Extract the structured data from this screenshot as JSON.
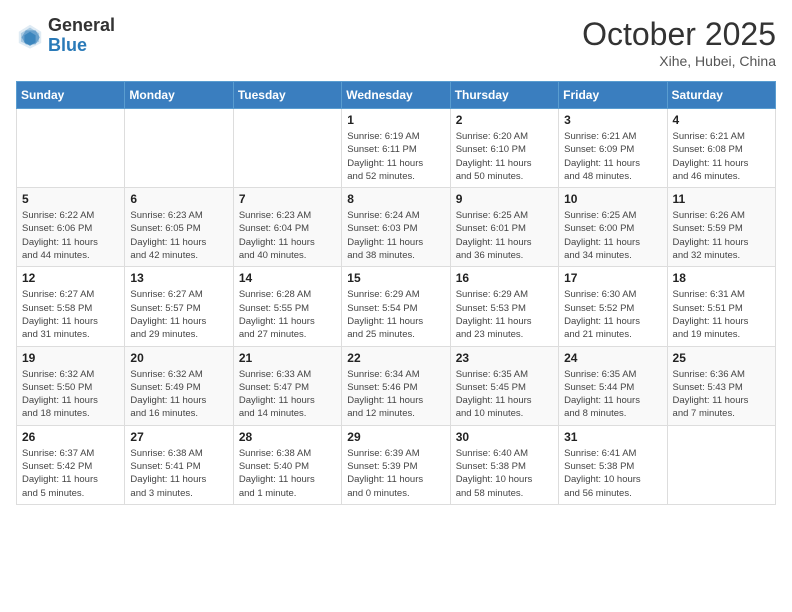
{
  "header": {
    "logo_general": "General",
    "logo_blue": "Blue",
    "month_title": "October 2025",
    "location": "Xihe, Hubei, China"
  },
  "weekdays": [
    "Sunday",
    "Monday",
    "Tuesday",
    "Wednesday",
    "Thursday",
    "Friday",
    "Saturday"
  ],
  "weeks": [
    [
      {
        "day": "",
        "info": ""
      },
      {
        "day": "",
        "info": ""
      },
      {
        "day": "",
        "info": ""
      },
      {
        "day": "1",
        "info": "Sunrise: 6:19 AM\nSunset: 6:11 PM\nDaylight: 11 hours\nand 52 minutes."
      },
      {
        "day": "2",
        "info": "Sunrise: 6:20 AM\nSunset: 6:10 PM\nDaylight: 11 hours\nand 50 minutes."
      },
      {
        "day": "3",
        "info": "Sunrise: 6:21 AM\nSunset: 6:09 PM\nDaylight: 11 hours\nand 48 minutes."
      },
      {
        "day": "4",
        "info": "Sunrise: 6:21 AM\nSunset: 6:08 PM\nDaylight: 11 hours\nand 46 minutes."
      }
    ],
    [
      {
        "day": "5",
        "info": "Sunrise: 6:22 AM\nSunset: 6:06 PM\nDaylight: 11 hours\nand 44 minutes."
      },
      {
        "day": "6",
        "info": "Sunrise: 6:23 AM\nSunset: 6:05 PM\nDaylight: 11 hours\nand 42 minutes."
      },
      {
        "day": "7",
        "info": "Sunrise: 6:23 AM\nSunset: 6:04 PM\nDaylight: 11 hours\nand 40 minutes."
      },
      {
        "day": "8",
        "info": "Sunrise: 6:24 AM\nSunset: 6:03 PM\nDaylight: 11 hours\nand 38 minutes."
      },
      {
        "day": "9",
        "info": "Sunrise: 6:25 AM\nSunset: 6:01 PM\nDaylight: 11 hours\nand 36 minutes."
      },
      {
        "day": "10",
        "info": "Sunrise: 6:25 AM\nSunset: 6:00 PM\nDaylight: 11 hours\nand 34 minutes."
      },
      {
        "day": "11",
        "info": "Sunrise: 6:26 AM\nSunset: 5:59 PM\nDaylight: 11 hours\nand 32 minutes."
      }
    ],
    [
      {
        "day": "12",
        "info": "Sunrise: 6:27 AM\nSunset: 5:58 PM\nDaylight: 11 hours\nand 31 minutes."
      },
      {
        "day": "13",
        "info": "Sunrise: 6:27 AM\nSunset: 5:57 PM\nDaylight: 11 hours\nand 29 minutes."
      },
      {
        "day": "14",
        "info": "Sunrise: 6:28 AM\nSunset: 5:55 PM\nDaylight: 11 hours\nand 27 minutes."
      },
      {
        "day": "15",
        "info": "Sunrise: 6:29 AM\nSunset: 5:54 PM\nDaylight: 11 hours\nand 25 minutes."
      },
      {
        "day": "16",
        "info": "Sunrise: 6:29 AM\nSunset: 5:53 PM\nDaylight: 11 hours\nand 23 minutes."
      },
      {
        "day": "17",
        "info": "Sunrise: 6:30 AM\nSunset: 5:52 PM\nDaylight: 11 hours\nand 21 minutes."
      },
      {
        "day": "18",
        "info": "Sunrise: 6:31 AM\nSunset: 5:51 PM\nDaylight: 11 hours\nand 19 minutes."
      }
    ],
    [
      {
        "day": "19",
        "info": "Sunrise: 6:32 AM\nSunset: 5:50 PM\nDaylight: 11 hours\nand 18 minutes."
      },
      {
        "day": "20",
        "info": "Sunrise: 6:32 AM\nSunset: 5:49 PM\nDaylight: 11 hours\nand 16 minutes."
      },
      {
        "day": "21",
        "info": "Sunrise: 6:33 AM\nSunset: 5:47 PM\nDaylight: 11 hours\nand 14 minutes."
      },
      {
        "day": "22",
        "info": "Sunrise: 6:34 AM\nSunset: 5:46 PM\nDaylight: 11 hours\nand 12 minutes."
      },
      {
        "day": "23",
        "info": "Sunrise: 6:35 AM\nSunset: 5:45 PM\nDaylight: 11 hours\nand 10 minutes."
      },
      {
        "day": "24",
        "info": "Sunrise: 6:35 AM\nSunset: 5:44 PM\nDaylight: 11 hours\nand 8 minutes."
      },
      {
        "day": "25",
        "info": "Sunrise: 6:36 AM\nSunset: 5:43 PM\nDaylight: 11 hours\nand 7 minutes."
      }
    ],
    [
      {
        "day": "26",
        "info": "Sunrise: 6:37 AM\nSunset: 5:42 PM\nDaylight: 11 hours\nand 5 minutes."
      },
      {
        "day": "27",
        "info": "Sunrise: 6:38 AM\nSunset: 5:41 PM\nDaylight: 11 hours\nand 3 minutes."
      },
      {
        "day": "28",
        "info": "Sunrise: 6:38 AM\nSunset: 5:40 PM\nDaylight: 11 hours\nand 1 minute."
      },
      {
        "day": "29",
        "info": "Sunrise: 6:39 AM\nSunset: 5:39 PM\nDaylight: 11 hours\nand 0 minutes."
      },
      {
        "day": "30",
        "info": "Sunrise: 6:40 AM\nSunset: 5:38 PM\nDaylight: 10 hours\nand 58 minutes."
      },
      {
        "day": "31",
        "info": "Sunrise: 6:41 AM\nSunset: 5:38 PM\nDaylight: 10 hours\nand 56 minutes."
      },
      {
        "day": "",
        "info": ""
      }
    ]
  ]
}
